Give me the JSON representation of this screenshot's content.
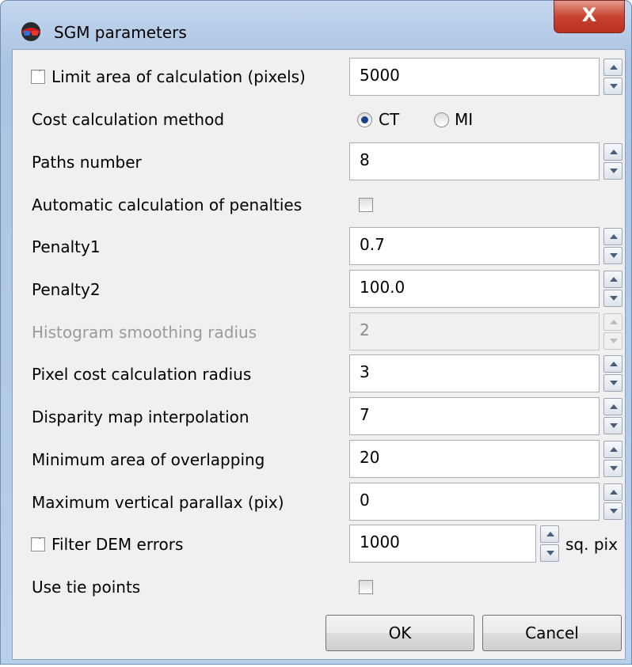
{
  "window": {
    "title": "SGM parameters",
    "close_label": "X"
  },
  "fields": {
    "limit_area": {
      "label": "Limit area of calculation (pixels)",
      "checked": true,
      "value": "5000"
    },
    "cost_method": {
      "label": "Cost calculation method",
      "options": [
        "CT",
        "MI"
      ],
      "selected": "CT"
    },
    "paths_number": {
      "label": "Paths number",
      "value": "8"
    },
    "auto_penalties": {
      "label": "Automatic calculation of penalties",
      "checked": false
    },
    "penalty1": {
      "label": "Penalty1",
      "value": "0.7"
    },
    "penalty2": {
      "label": "Penalty2",
      "value": "100.0"
    },
    "histogram_radius": {
      "label": "Histogram smoothing radius",
      "value": "2",
      "disabled": true
    },
    "pixel_cost_radius": {
      "label": "Pixel cost calculation radius",
      "value": "3"
    },
    "disparity_interp": {
      "label": "Disparity map interpolation",
      "value": "7"
    },
    "min_overlap": {
      "label": "Minimum area of overlapping",
      "value": "20"
    },
    "max_parallax": {
      "label": "Maximum vertical parallax (pix)",
      "value": "0"
    },
    "filter_dem": {
      "label": "Filter DEM errors",
      "checked": true,
      "value": "1000",
      "unit": "sq. pix"
    },
    "tie_points": {
      "label": "Use tie points",
      "checked": false
    }
  },
  "buttons": {
    "ok": "OK",
    "cancel": "Cancel"
  },
  "icons": {
    "app": "stereo-glasses-icon",
    "close": "close-icon"
  },
  "colors": {
    "frame": "#b9d0ea",
    "close": "#c8422f",
    "client_bg": "#f0f0f0"
  }
}
